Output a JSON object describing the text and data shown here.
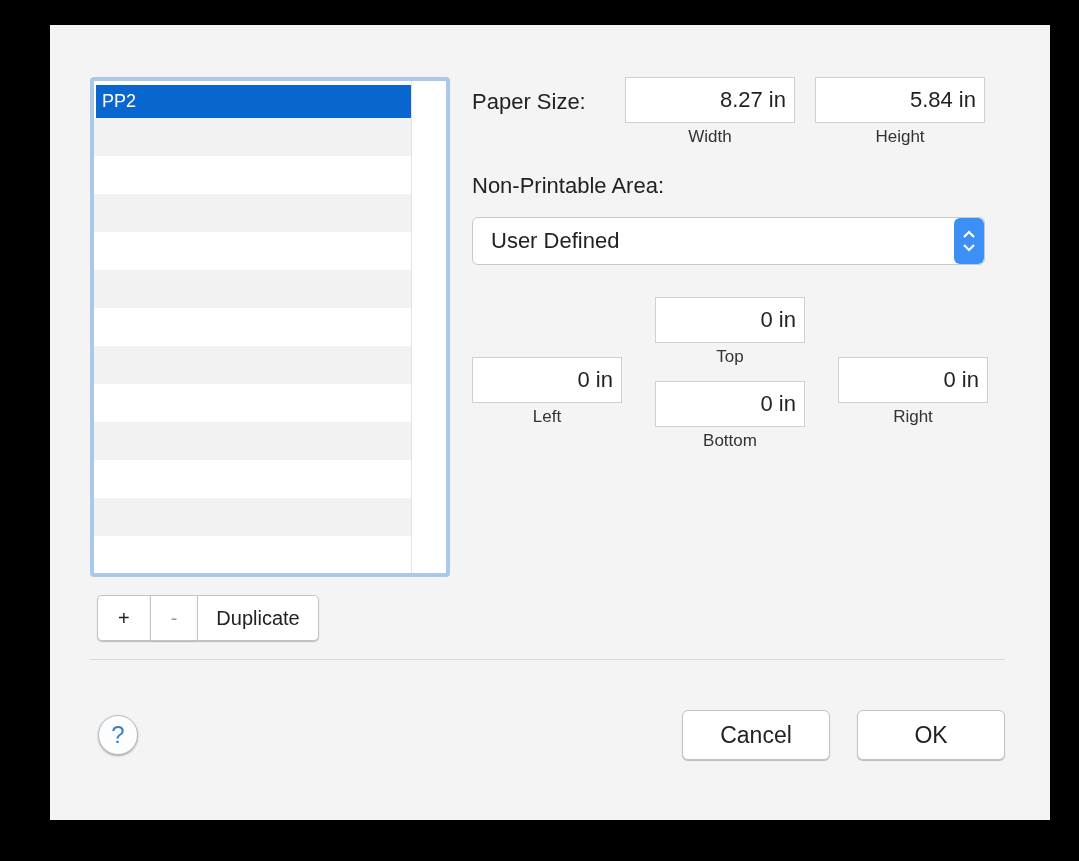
{
  "paper_list": {
    "items": [
      {
        "label": "PP2",
        "selected": true
      }
    ]
  },
  "list_buttons": [
    {
      "label": "+",
      "disabled": false
    },
    {
      "label": "-",
      "disabled": true
    },
    {
      "label": "Duplicate",
      "disabled": false
    }
  ],
  "paper_size": {
    "label": "Paper Size:",
    "width": {
      "value": "8.27 in",
      "caption": "Width"
    },
    "height": {
      "value": "5.84 in",
      "caption": "Height"
    }
  },
  "non_printable_area": {
    "label": "Non-Printable Area:",
    "selection": "User Defined",
    "left": {
      "value": "0 in",
      "caption": "Left"
    },
    "top": {
      "value": "0 in",
      "caption": "Top"
    },
    "bottom": {
      "value": "0 in",
      "caption": "Bottom"
    },
    "right": {
      "value": "0 in",
      "caption": "Right"
    }
  },
  "help_button": {
    "label": "?"
  },
  "buttons": [
    {
      "label": "Cancel"
    },
    {
      "label": "OK"
    }
  ]
}
